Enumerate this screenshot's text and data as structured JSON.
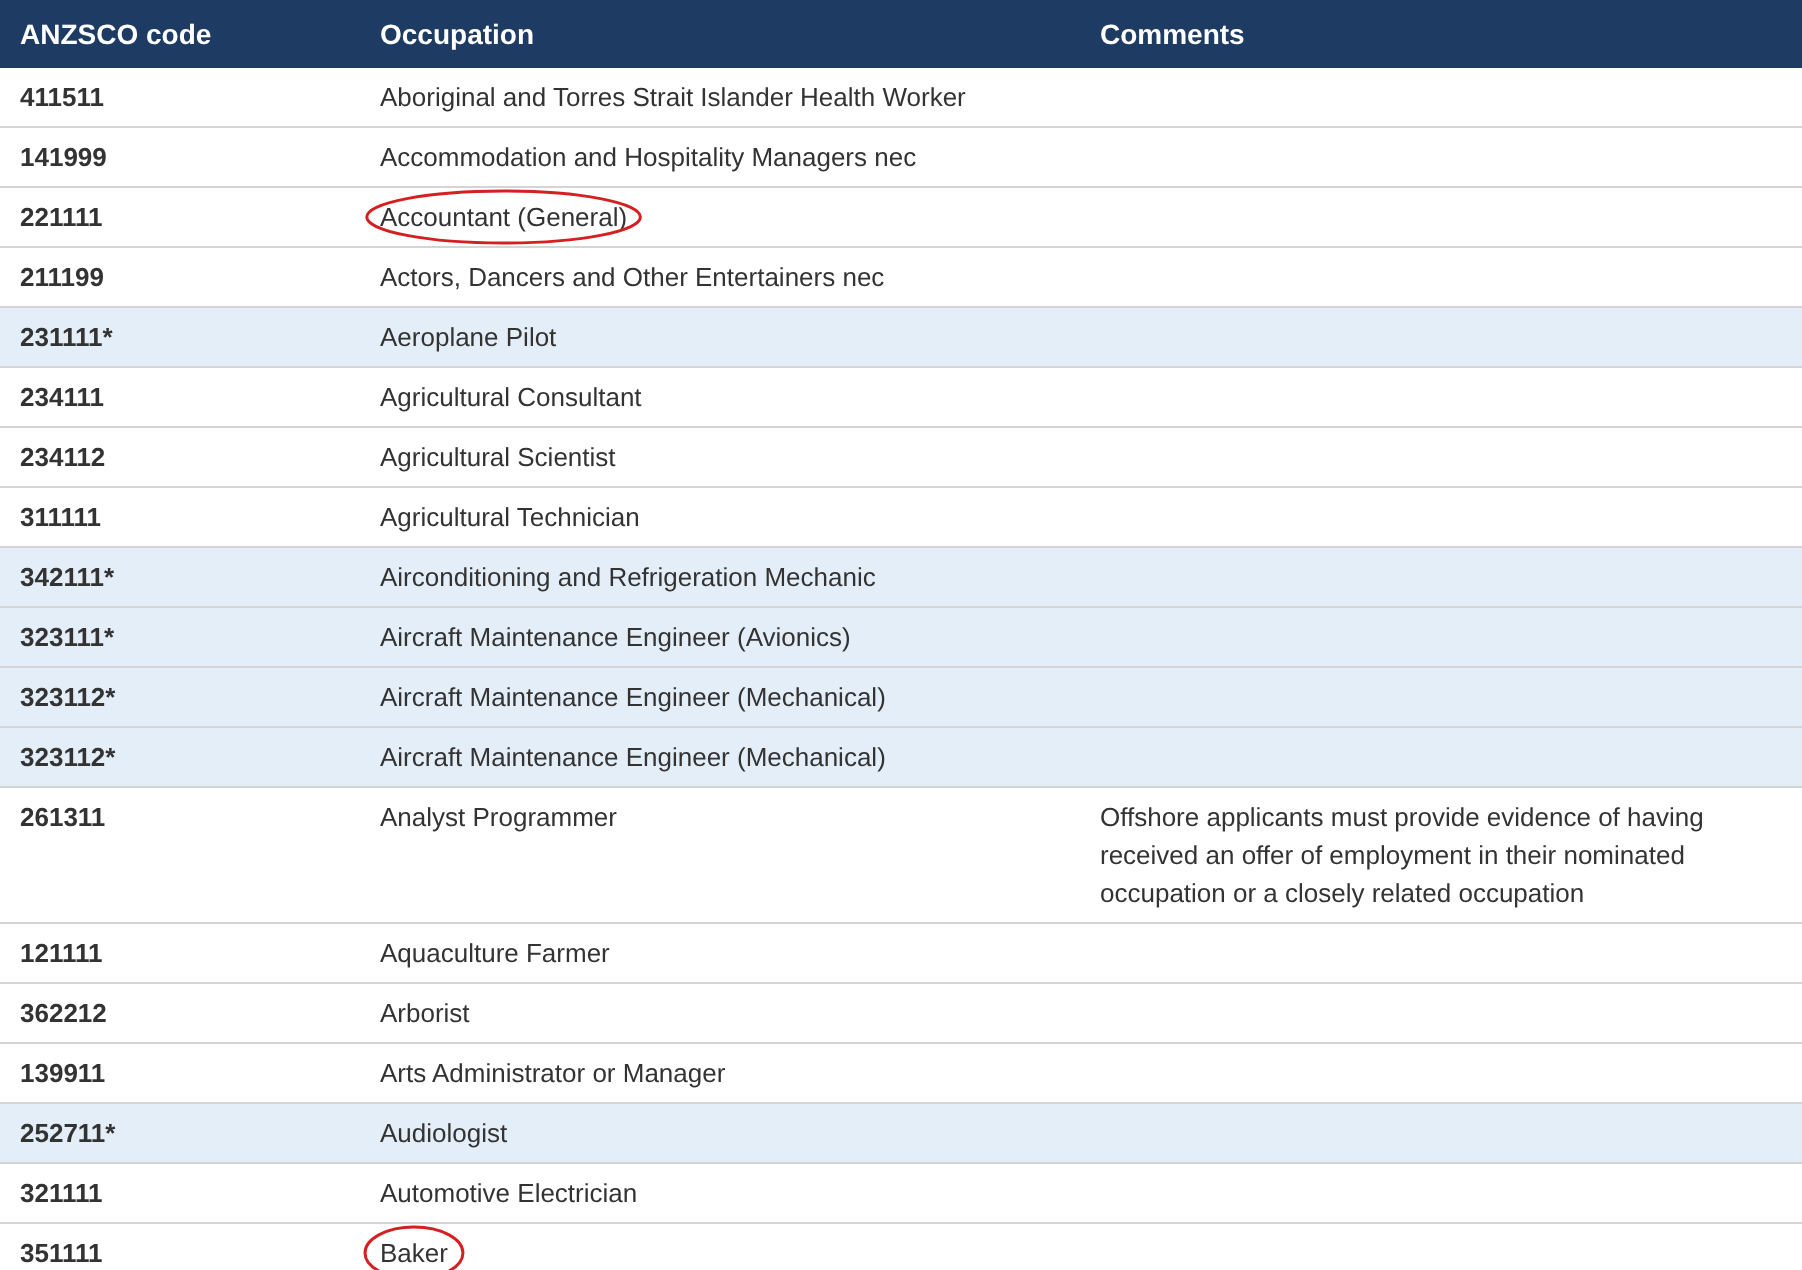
{
  "table": {
    "columns": [
      "ANZSCO code",
      "Occupation",
      "Comments"
    ],
    "rows": [
      {
        "code": "411511",
        "occupation": "Aboriginal and Torres Strait Islander Health Worker",
        "highlighted": false,
        "circled": false
      },
      {
        "code": "141999",
        "occupation": "Accommodation and Hospitality Managers nec",
        "highlighted": false,
        "circled": false
      },
      {
        "code": "221111",
        "occupation": "Accountant (General)",
        "highlighted": false,
        "circled": true
      },
      {
        "code": "211199",
        "occupation": "Actors, Dancers and Other Entertainers nec",
        "highlighted": false,
        "circled": false
      },
      {
        "code": "231111*",
        "occupation": "Aeroplane Pilot",
        "highlighted": true,
        "circled": false
      },
      {
        "code": "234111",
        "occupation": "Agricultural Consultant",
        "highlighted": false,
        "circled": false
      },
      {
        "code": "234112",
        "occupation": "Agricultural Scientist",
        "highlighted": false,
        "circled": false
      },
      {
        "code": "311111",
        "occupation": "Agricultural Technician",
        "highlighted": false,
        "circled": false
      },
      {
        "code": "342111*",
        "occupation": "Airconditioning and Refrigeration Mechanic",
        "highlighted": true,
        "circled": false
      },
      {
        "code": "323111*",
        "occupation": "Aircraft Maintenance Engineer (Avionics)",
        "highlighted": true,
        "circled": false
      },
      {
        "code": "323112*",
        "occupation": "Aircraft Maintenance Engineer (Mechanical)",
        "highlighted": true,
        "circled": false
      },
      {
        "code": "323112*",
        "occupation": "Aircraft Maintenance Engineer (Mechanical)",
        "highlighted": true,
        "circled": false
      },
      {
        "code": "261311",
        "occupation": "Analyst Programmer",
        "comment": "Offshore applicants must provide evidence of having received an offer of employment in their nominated occupation or a closely related occupation",
        "highlighted": false,
        "circled": false
      },
      {
        "code": "121111",
        "occupation": "Aquaculture Farmer",
        "highlighted": false,
        "circled": false
      },
      {
        "code": "362212",
        "occupation": "Arborist",
        "highlighted": false,
        "circled": false
      },
      {
        "code": "139911",
        "occupation": "Arts Administrator or Manager",
        "highlighted": false,
        "circled": false
      },
      {
        "code": "252711*",
        "occupation": "Audiologist",
        "highlighted": true,
        "circled": false
      },
      {
        "code": "321111",
        "occupation": "Automotive Electrician",
        "highlighted": false,
        "circled": false
      },
      {
        "code": "351111",
        "occupation": "Baker",
        "highlighted": false,
        "circled": true
      }
    ]
  }
}
